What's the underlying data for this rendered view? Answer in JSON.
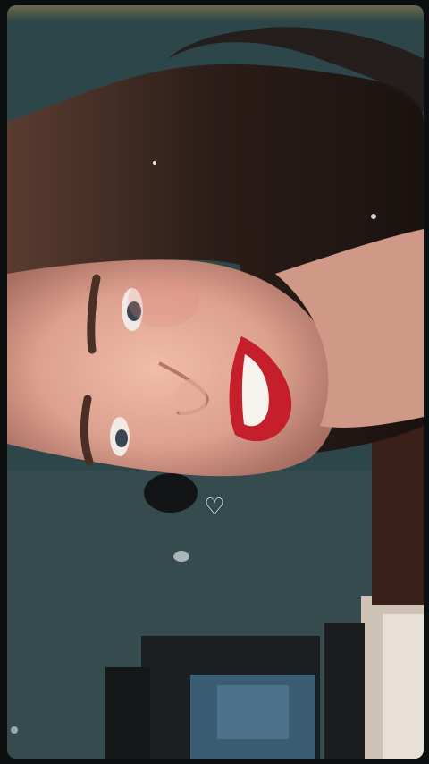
{
  "screen": {
    "heart_glyph": "♡"
  },
  "colors": {
    "background": "#0c0f10",
    "wall": "#2c4648",
    "hair": "#2a1d18",
    "skin": "#e2a795",
    "lips": "#c41f2a"
  }
}
